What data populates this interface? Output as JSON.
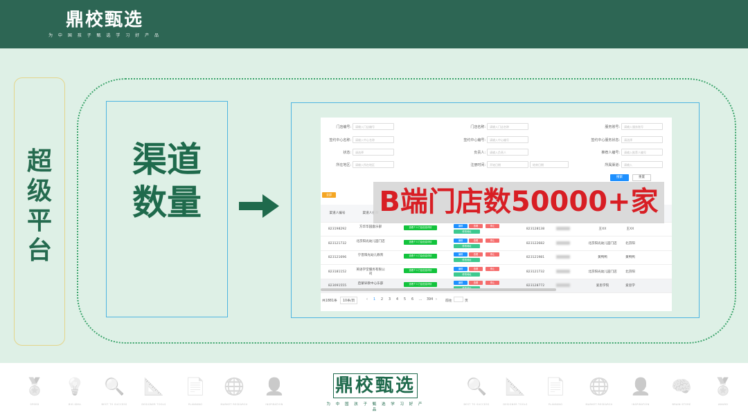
{
  "brand": {
    "name": "鼎校甄选",
    "tagline": "为 中 国 孩 子 甄 选 学 习 好 产 品"
  },
  "left_label": "超级平台",
  "concept_label": "渠道数量",
  "highlight": "B端门店数50000+家",
  "admin": {
    "form": [
      {
        "label": "门店编号:",
        "placeholder": "请输入门店编号"
      },
      {
        "label": "门店名称:",
        "placeholder": "请输入门店名称"
      },
      {
        "label": "服务账号:",
        "placeholder": "请输入服务账号"
      },
      {
        "label": "签约中心名称:",
        "placeholder": "请输入中心名称"
      },
      {
        "label": "签约中心编号:",
        "placeholder": "请输入中心编号"
      },
      {
        "label": "签约中心服务状态:",
        "placeholder": "请选择"
      },
      {
        "label": "状态:",
        "placeholder": "请选择"
      },
      {
        "label": "负责人:",
        "placeholder": "请输入负责人"
      },
      {
        "label": "推荐人编号:",
        "placeholder": "请输入推荐人编号"
      },
      {
        "label": "所在地区:",
        "placeholder": "请输入所在地区"
      },
      {
        "label": "注册时间:",
        "placeholder": "开始日期"
      },
      {
        "label": "所属渠道:",
        "placeholder": "请输入"
      }
    ],
    "date_end": "结束日期",
    "date_sep": "至",
    "search_label": "搜索",
    "reset_label": "重置",
    "tab_label": "全部",
    "headers": [
      "渠道人编号",
      "渠道人名称",
      "",
      "",
      "",
      "",
      "",
      ""
    ],
    "rows": [
      {
        "id": "823198292",
        "name": "方华华园盘乐部",
        "code": "823128138",
        "p1": "王XX"
      },
      {
        "id": "823121732",
        "name": "北京阳光幼儿园门店",
        "code": "823122682",
        "p1": "北京阳光幼儿园门店"
      },
      {
        "id": "823121696",
        "name": "宁晋阳光幼儿教育",
        "code": "823121981",
        "p1": "黄鸭鸭"
      },
      {
        "id": "823181152",
        "name": "英语学堂服务有限公司",
        "code": "823121732",
        "p1": "北京阳光幼儿园门店"
      },
      {
        "id": "823091555",
        "name": "启蒙早教中心乐部",
        "code": "823128772",
        "p1": "爱思学院"
      }
    ],
    "green_btn": "查看个人门店信息详情",
    "act_edit": "编辑",
    "act_view": "查看",
    "act_stop": "停止",
    "act_more": "修改地址",
    "pager": {
      "total": "共1881条",
      "size": "10条/页",
      "pages": [
        "1",
        "2",
        "3",
        "4",
        "5",
        "6",
        "...",
        "394"
      ],
      "goto": "前往",
      "page_unit": "页"
    }
  },
  "footer": {
    "captions": [
      "SPEED",
      "BIG IDEA",
      "BEST TO SUCCESS",
      "DESIGNER TOOLS",
      "PLANNING",
      "MARKET RESEARCH",
      "INSPIRATION",
      "",
      "BEST TO SUCCESS",
      "DESIGNER TOOLS",
      "PLANNING",
      "MARKET RESEARCH",
      "INSPIRATION",
      "BRAIN STORE",
      "AWARD"
    ]
  },
  "colors": {
    "header": "#2d6654",
    "accent_green": "#1f6a4c",
    "highlight_red": "#d81e24"
  }
}
